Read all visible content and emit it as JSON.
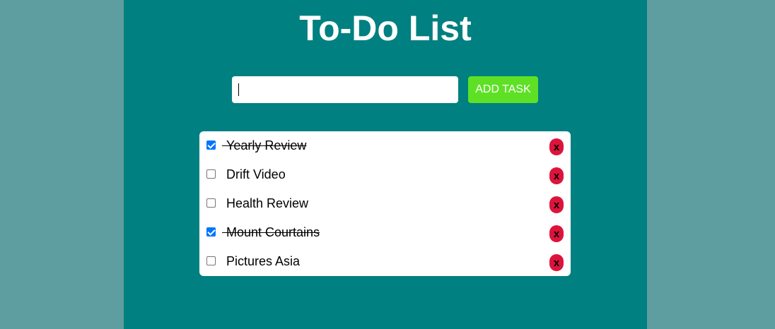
{
  "header": {
    "title": "To-Do List"
  },
  "form": {
    "input_value": "",
    "add_button_label": "ADD TASK"
  },
  "tasks": [
    {
      "text": "Yearly Review",
      "done": true,
      "delete_label": "x"
    },
    {
      "text": "Drift Video",
      "done": false,
      "delete_label": "x"
    },
    {
      "text": "Health Review",
      "done": false,
      "delete_label": "x"
    },
    {
      "text": "Mount Courtains",
      "done": true,
      "delete_label": "x"
    },
    {
      "text": "Pictures Asia",
      "done": false,
      "delete_label": "x"
    }
  ],
  "colors": {
    "page_background": "#5f9ea0",
    "app_background": "#008080",
    "add_button": "#5ee025",
    "delete_button": "#dc143c",
    "checkbox_checked": "#0075ff"
  }
}
